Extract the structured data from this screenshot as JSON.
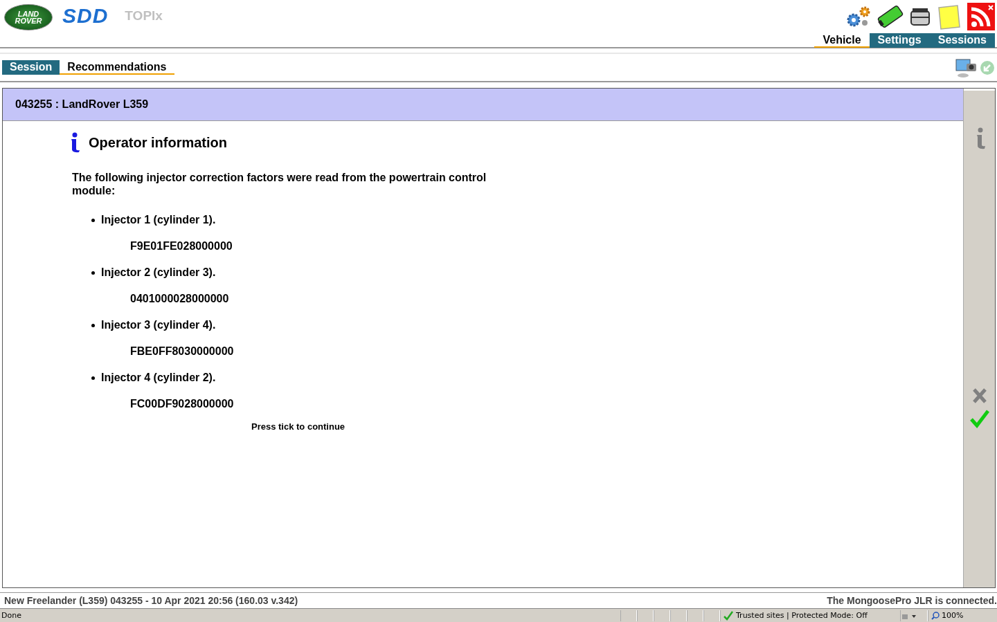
{
  "header": {
    "logo_lines": [
      "LAND",
      "ROVER"
    ],
    "brand": "SDD",
    "product": "TOPIx"
  },
  "main_tabs": [
    {
      "label": "Vehicle",
      "selected": true
    },
    {
      "label": "Settings",
      "selected": false
    },
    {
      "label": "Sessions",
      "selected": false
    }
  ],
  "sub_tabs": [
    {
      "label": "Session",
      "selected": false
    },
    {
      "label": "Recommendations",
      "selected": true
    }
  ],
  "panel": {
    "title": "043255 : LandRover L359",
    "heading": "Operator information",
    "intro": "The following injector correction factors were read from the powertrain control module:",
    "injectors": [
      {
        "label": "Injector 1 (cylinder 1).",
        "code": "F9E01FE028000000"
      },
      {
        "label": "Injector 2 (cylinder 3).",
        "code": "0401000028000000"
      },
      {
        "label": "Injector 3 (cylinder 4).",
        "code": "FBE0FF8030000000"
      },
      {
        "label": "Injector 4 (cylinder 2).",
        "code": "FC00DF9028000000"
      }
    ],
    "prompt": "Press tick to continue"
  },
  "footer": {
    "left": "New Freelander (L359) 043255 - 10 Apr 2021 20:56 (160.03 v.342)",
    "right": "The MongoosePro JLR is connected."
  },
  "status_bar": {
    "status": "Done",
    "zone": "Trusted sites | Protected Mode: Off",
    "zoom": "100%"
  }
}
